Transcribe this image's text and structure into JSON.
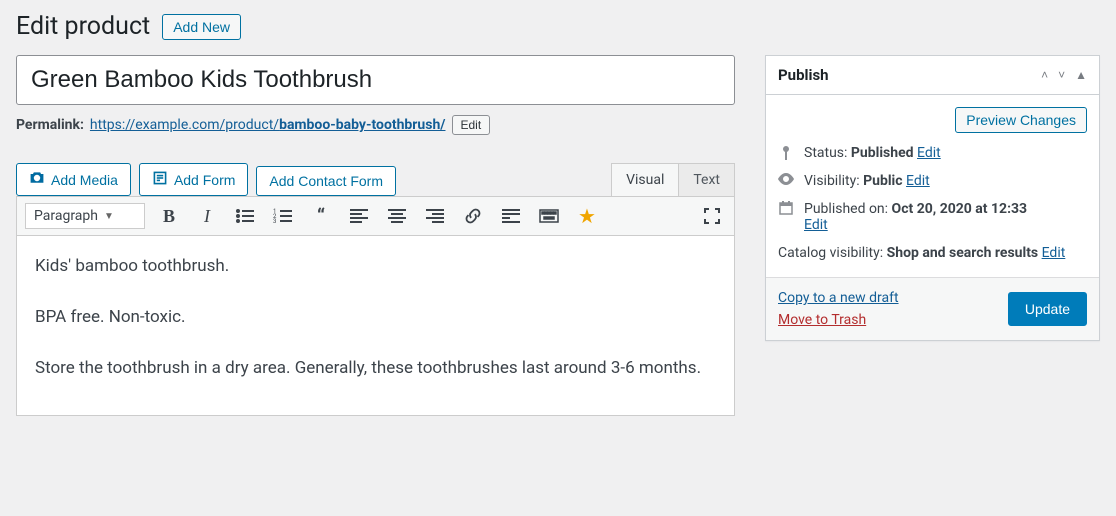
{
  "header": {
    "title": "Edit product",
    "add_new": "Add New"
  },
  "product": {
    "title_value": "Green Bamboo Kids Toothbrush",
    "permalink_label": "Permalink:",
    "permalink_base": "https://example.com/product/",
    "permalink_slug": "bamboo-baby-toothbrush/",
    "permalink_edit": "Edit"
  },
  "editor": {
    "add_media": "Add Media",
    "add_form": "Add Form",
    "add_contact_form": "Add Contact Form",
    "tabs": {
      "visual": "Visual",
      "text": "Text"
    },
    "format": "Paragraph",
    "body": [
      "Kids' bamboo toothbrush.",
      "BPA free. Non-toxic.",
      "Store the toothbrush in a dry area. Generally, these toothbrushes last around 3-6 months."
    ]
  },
  "publish": {
    "title": "Publish",
    "preview": "Preview Changes",
    "status_label": "Status:",
    "status_value": "Published",
    "visibility_label": "Visibility:",
    "visibility_value": "Public",
    "published_on_label": "Published on:",
    "published_on_value": "Oct 20, 2020 at 12:33",
    "catalog_label": "Catalog visibility:",
    "catalog_value": "Shop and search results",
    "edit": "Edit",
    "copy": "Copy to a new draft",
    "trash": "Move to Trash",
    "update": "Update"
  }
}
